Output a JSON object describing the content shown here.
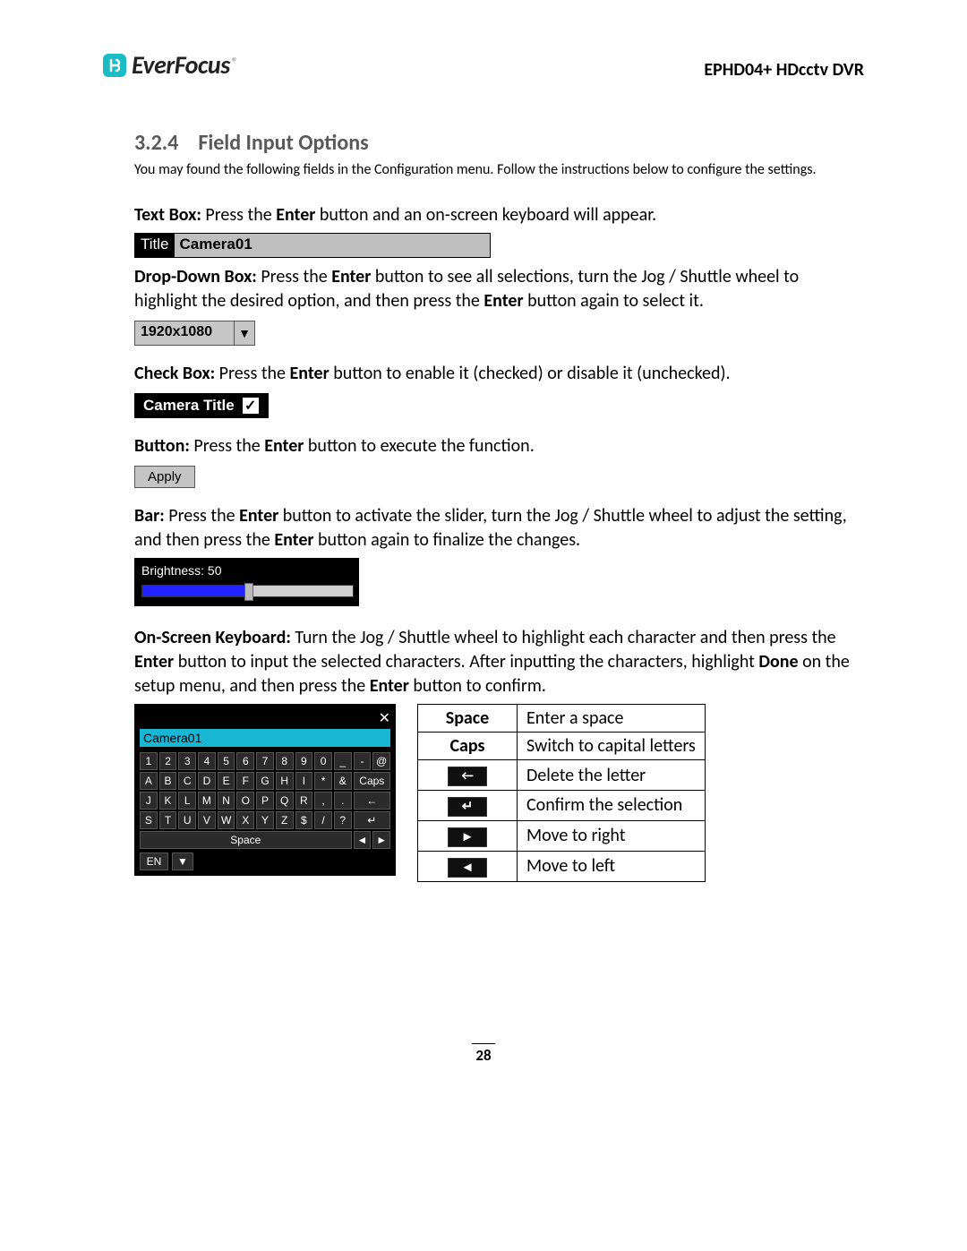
{
  "header": {
    "brand": "EverFocus",
    "doc_id": "EPHD04+  HDcctv DVR"
  },
  "section": {
    "number": "3.2.4",
    "title": "Field Input Options",
    "intro": "You may found the following fields in the Configuration menu. Follow the instructions below to configure the settings."
  },
  "textbox": {
    "lead_label": "Text Box:",
    "desc_a": " Press the ",
    "desc_b": " button and an on-screen keyboard will appear.",
    "enter": "Enter",
    "widget_label": "Title",
    "widget_value": "Camera01"
  },
  "dropdown": {
    "lead_label": "Drop-Down Box:",
    "desc_a": " Press the ",
    "enter1": "Enter",
    "desc_b": " button to see all selections, turn the Jog / Shuttle wheel to highlight the desired option, and then press the ",
    "enter2": "Enter",
    "desc_c": " button again to select it.",
    "value": "1920x1080"
  },
  "checkbox": {
    "lead_label": "Check Box:",
    "desc_a": " Press the ",
    "enter": "Enter",
    "desc_b": " button to enable it (checked) or disable it (unchecked).",
    "label": "Camera Title"
  },
  "button": {
    "lead_label": "Button:",
    "desc_a": " Press the ",
    "enter": "Enter",
    "desc_b": " button to execute the function.",
    "label": "Apply"
  },
  "bar": {
    "lead_label": "Bar:",
    "desc_a": " Press the ",
    "enter1": "Enter",
    "desc_b": " button to activate the slider, turn the Jog / Shuttle wheel to adjust the setting, and then press the ",
    "enter2": "Enter",
    "desc_c": " button again to finalize the changes.",
    "caption": "Brightness: 50"
  },
  "osk": {
    "lead_label": "On-Screen Keyboard:",
    "desc_a": " Turn the Jog / Shuttle wheel to highlight each character and then press the ",
    "enter1": "Enter",
    "desc_b": " button to input the selected characters. After inputting the characters, highlight ",
    "done": "Done",
    "desc_c": " on the setup menu, and then press the ",
    "enter2": "Enter",
    "desc_d": " button to confirm.",
    "input_value": "Camera01",
    "rows": {
      "r1": [
        "1",
        "2",
        "3",
        "4",
        "5",
        "6",
        "7",
        "8",
        "9",
        "0",
        "_",
        "-",
        "@"
      ],
      "r2": [
        "A",
        "B",
        "C",
        "D",
        "E",
        "F",
        "G",
        "H",
        "I",
        "*",
        "&",
        "Caps"
      ],
      "r3": [
        "J",
        "K",
        "L",
        "M",
        "N",
        "O",
        "P",
        "Q",
        "R",
        ",",
        ".",
        "←"
      ],
      "r4": [
        "S",
        "T",
        "U",
        "V",
        "W",
        "X",
        "Y",
        "Z",
        "$",
        "/",
        "?",
        "↵"
      ],
      "space": "Space",
      "left": "◄",
      "right": "►",
      "lang": "EN"
    },
    "close": "✕"
  },
  "legend": {
    "rows": [
      {
        "k": "Space",
        "v": "Enter a space",
        "icon": ""
      },
      {
        "k": "Caps",
        "v": "Switch to capital letters",
        "icon": ""
      },
      {
        "k": "",
        "v": "Delete the letter",
        "icon": "←"
      },
      {
        "k": "",
        "v": "Confirm the selection",
        "icon": "↵"
      },
      {
        "k": "",
        "v": "Move to right",
        "icon": "►"
      },
      {
        "k": "",
        "v": "Move to left",
        "icon": "◄"
      }
    ]
  },
  "page_number": "28"
}
